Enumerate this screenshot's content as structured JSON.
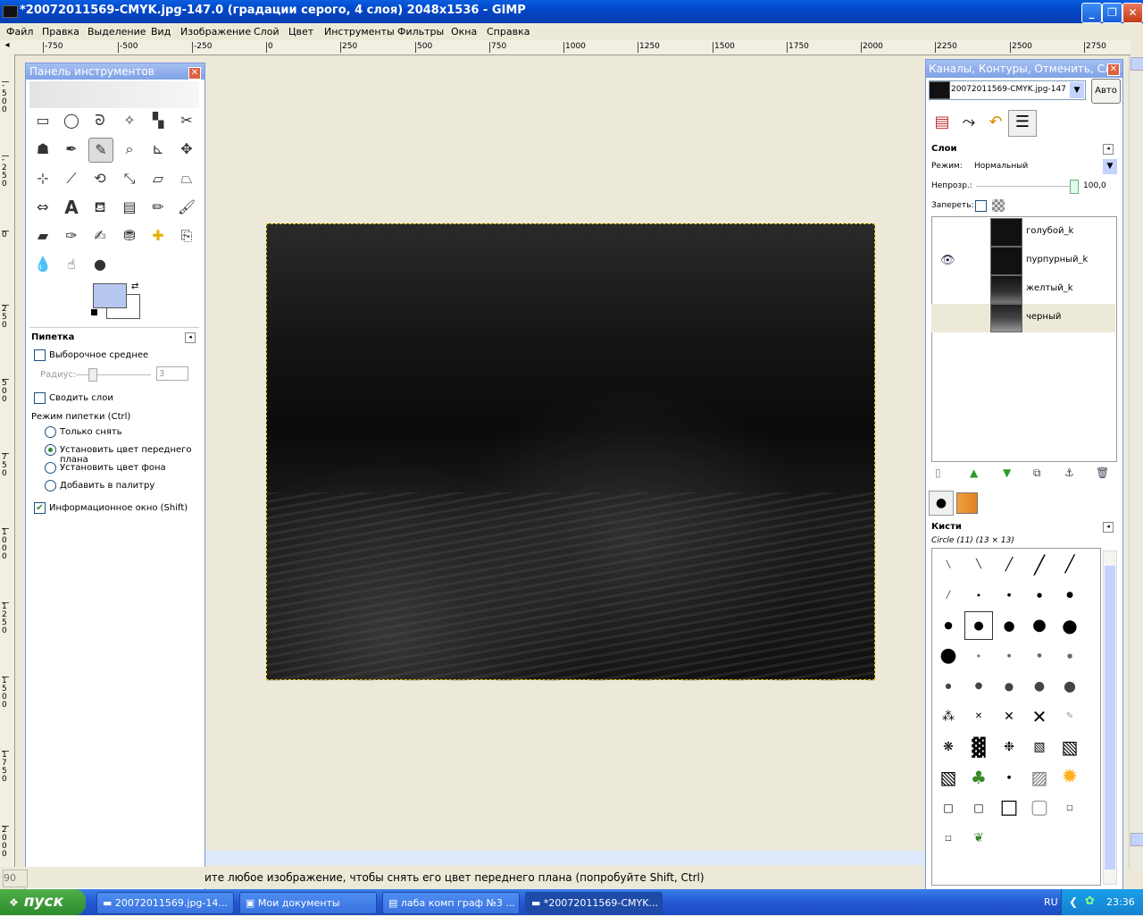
{
  "window": {
    "title": "*20072011569-CMYK.jpg-147.0 (градации серого, 4 слоя) 2048x1536 - GIMP"
  },
  "menu": [
    "Файл",
    "Правка",
    "Выделение",
    "Вид",
    "Изображение",
    "Слой",
    "Цвет",
    "Инструменты",
    "Фильтры",
    "Окна",
    "Справка"
  ],
  "hruler": [
    "-750",
    "-500",
    "-250",
    "0",
    "250",
    "500",
    "750",
    "1000",
    "1250",
    "1500",
    "1750",
    "2000",
    "2250",
    "2500",
    "2750"
  ],
  "vruler": [
    "-500",
    "-250",
    "0",
    "250",
    "500",
    "750",
    "1000",
    "1250",
    "1500",
    "1750",
    "2000"
  ],
  "toolbox": {
    "title": "Панель инструментов",
    "tools": [
      "rect-select",
      "ellipse-select",
      "free-select",
      "fuzzy-select",
      "by-color-select",
      "scissors",
      "foreground-select",
      "paths",
      "color-picker",
      "zoom",
      "measure",
      "move",
      "align",
      "crop",
      "rotate",
      "scale",
      "shear",
      "perspective",
      "flip",
      "text",
      "bucket-fill",
      "blend",
      "pencil",
      "paintbrush",
      "eraser",
      "airbrush",
      "ink",
      "clone",
      "heal",
      "perspective-clone",
      "blur",
      "smudge",
      "dodge-burn"
    ],
    "fg_color": "#b6c8ef",
    "bg_color": "#ffffff",
    "options_title": "Пипетка",
    "sample_average": "Выборочное среднее",
    "radius_label": "Радиус:",
    "radius_value": "3",
    "sample_merged": "Сводить слои",
    "mode_label": "Режим пипетки  (Ctrl)",
    "modes": [
      "Только снять",
      "Установить цвет переднего плана",
      "Установить цвет фона",
      "Добавить в палитру"
    ],
    "selected_mode": 1,
    "info_window": "Информационное окно  (Shift)"
  },
  "dock": {
    "title": "Каналы, Контуры, Отменить, Сло...",
    "image_select": "20072011569-CMYK.jpg-147",
    "auto_button": "Авто",
    "layers_title": "Слои",
    "mode_label": "Режим:",
    "mode_value": "Нормальный",
    "opacity_label": "Непрозр.:",
    "opacity_value": "100,0",
    "lock_label": "Запереть:",
    "layers": [
      {
        "name": "голубой_k",
        "visible": false
      },
      {
        "name": "пурпурный_k",
        "visible": true
      },
      {
        "name": "желтый_k",
        "visible": false
      },
      {
        "name": "черный",
        "visible": false
      }
    ],
    "brushes_title": "Кисти",
    "brush_selected": "Circle (11) (13 × 13)"
  },
  "statusbar": {
    "zoom": "90",
    "message": "ите любое изображение, чтобы снять его цвет переднего плана (попробуйте Shift, Ctrl)"
  },
  "taskbar": {
    "start": "пуск",
    "tasks": [
      "20072011569.jpg-14...",
      "Мои документы",
      "лаба комп граф №3 ...",
      "*20072011569-CMYK..."
    ],
    "active_task": 3,
    "lang": "RU",
    "time": "23:36"
  }
}
